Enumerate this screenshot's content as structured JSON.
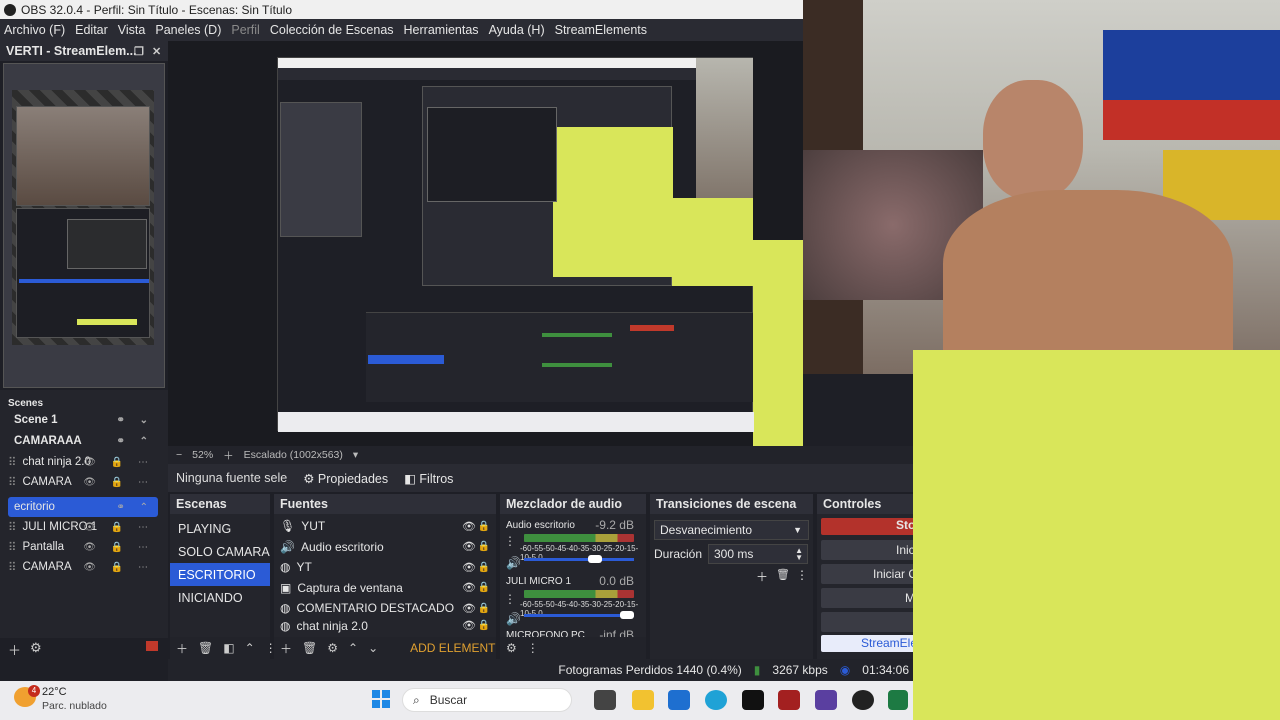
{
  "window": {
    "title": "OBS 32.0.4 - Perfil: Sin Título - Escenas: Sin Título"
  },
  "menu": [
    "Archivo (F)",
    "Editar",
    "Vista",
    "Paneles (D)",
    "Perfil",
    "Colección de Escenas",
    "Herramientas",
    "Ayuda (H)",
    "StreamElements"
  ],
  "dock": {
    "title": "VERTI - StreamElem..."
  },
  "left_scenes": {
    "header": "Scenes",
    "items": [
      {
        "label": "Scene 1",
        "bold": true
      },
      {
        "label": "CAMARAAA",
        "bold": true
      },
      {
        "label": "chat ninja 2.0"
      },
      {
        "label": "CAMARA"
      },
      {
        "label": "ecritorio",
        "selected": true
      },
      {
        "label": "JULI MICRO 1"
      },
      {
        "label": "Pantalla"
      },
      {
        "label": "CAMARA"
      }
    ]
  },
  "preview": {
    "zoom": "52%",
    "scaling": "Escalado (1002x563)"
  },
  "source_bar": {
    "selected": "Ninguna fuente sele",
    "properties": "Propiedades",
    "filters": "Filtros"
  },
  "scenes_dock": {
    "title": "Escenas",
    "items": [
      "PLAYING",
      "SOLO CAMARA",
      "ESCRITORIO",
      "INICIANDO"
    ],
    "selected_index": 2
  },
  "sources_dock": {
    "title": "Fuentes",
    "items": [
      {
        "label": "YUT",
        "icon": "mic-icon"
      },
      {
        "label": "Audio escritorio",
        "icon": "speaker-icon"
      },
      {
        "label": "YT",
        "icon": "globe-icon"
      },
      {
        "label": "Captura de ventana",
        "icon": "window-icon"
      },
      {
        "label": "COMENTARIO DESTACADO",
        "icon": "globe-icon"
      },
      {
        "label": "chat ninja 2.0",
        "icon": "globe-icon"
      }
    ],
    "add_element": "ADD ELEMENT"
  },
  "mixer": {
    "title": "Mezclador de audio",
    "channels": [
      {
        "name": "Audio escritorio",
        "db": "-9.2 dB"
      },
      {
        "name": "JULI MICRO 1",
        "db": "0.0 dB"
      },
      {
        "name": "MICROFONO PC",
        "db": "-inf dB"
      }
    ],
    "scale": "-60-55-50-45-40-35-30-25-20-15-10-5 0"
  },
  "transitions": {
    "title": "Transiciones de escena",
    "selected": "Desvanecimiento",
    "duration_label": "Duración",
    "duration": "300 ms"
  },
  "controls": {
    "title": "Controles",
    "buttons": [
      "Sto",
      "Inic",
      "Iniciar C",
      "M",
      "",
      "StreamEle"
    ]
  },
  "status": {
    "dropped": "Fotogramas Perdidos 1440 (0.4%)",
    "bitrate": "3267 kbps",
    "time": "01:34:06"
  },
  "taskbar": {
    "temp": "22°C",
    "weather": "Parc. nublado",
    "badge": "4",
    "search": "Buscar"
  }
}
